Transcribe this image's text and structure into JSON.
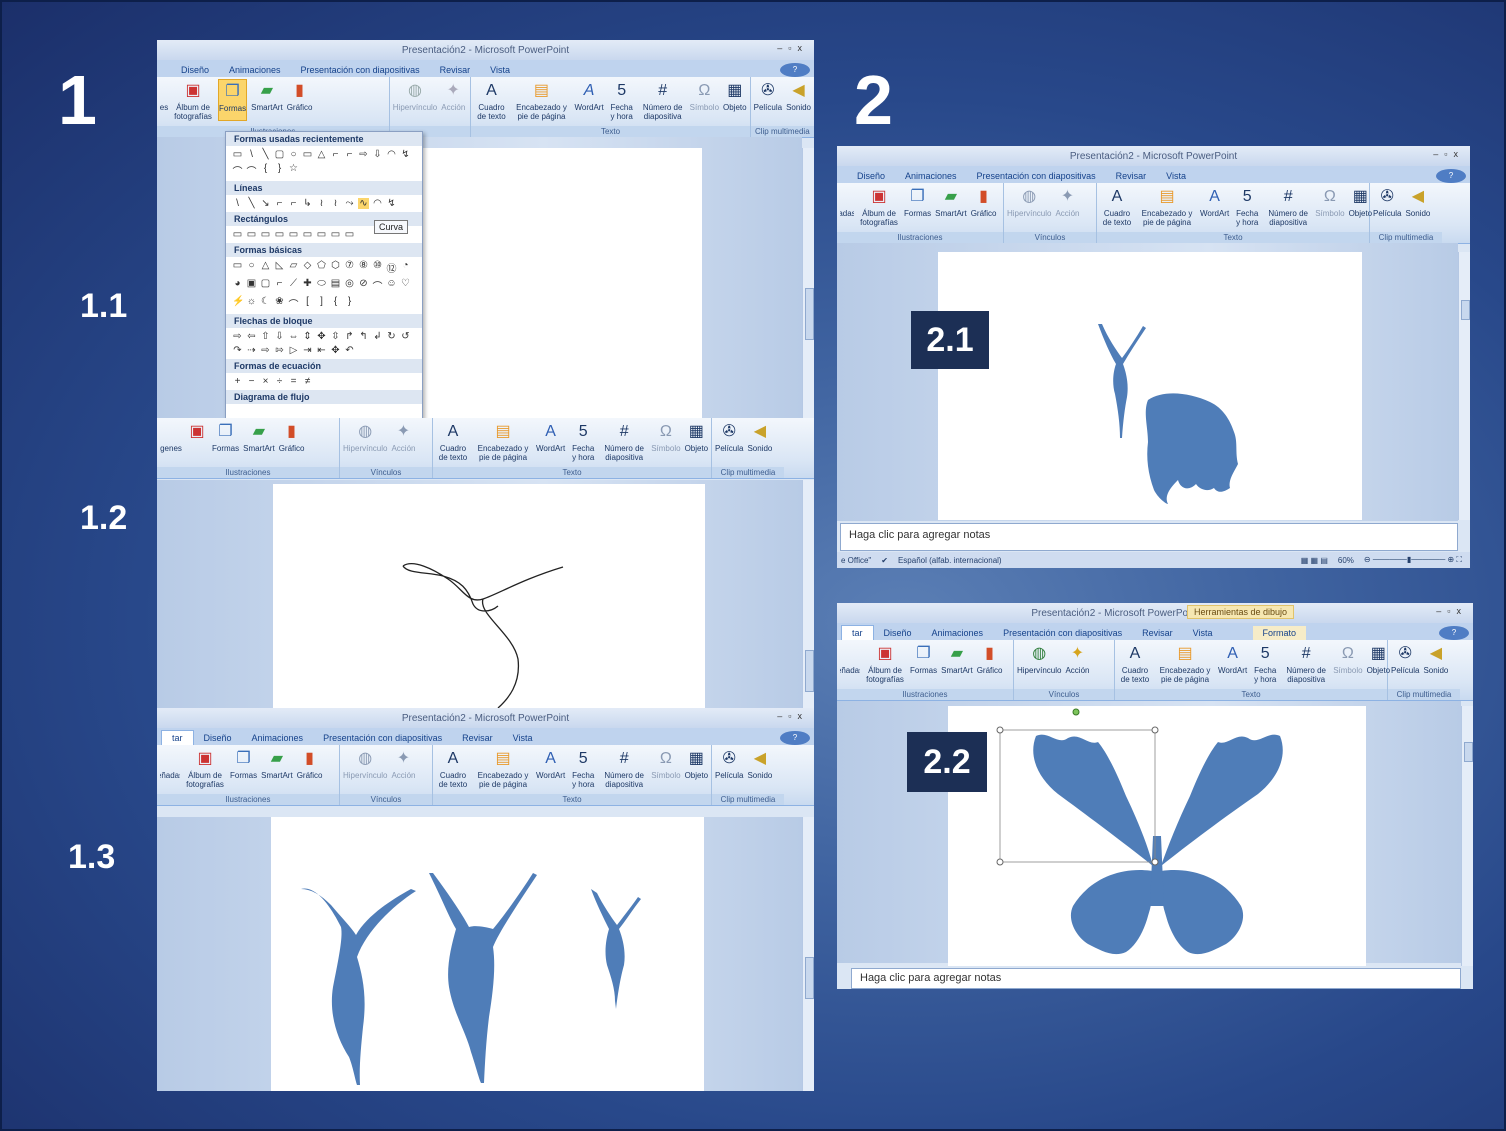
{
  "labels": {
    "n1": "1",
    "n2": "2",
    "s11": "1.1",
    "s12": "1.2",
    "s13": "1.3",
    "s21": "2.1",
    "s22": "2.2"
  },
  "window": {
    "title": "Presentación2 - Microsoft PowerPoint",
    "tabs": [
      "Diseño",
      "Animaciones",
      "Presentación con diapositivas",
      "Revisar",
      "Vista"
    ],
    "tabs_short": [
      "tar",
      "Diseño",
      "Animaciones",
      "Presentación con diapositivas",
      "Revisar",
      "Vista"
    ],
    "tabs_2_1": [
      "Diseño",
      "Animaciones",
      "Presentación con diapositivas",
      "Revisar",
      "Vista"
    ],
    "drawing_tools": "Herramientas de dibujo",
    "format_tab": "Formato"
  },
  "ribbon": {
    "ilu": [
      "Álbum de fotografías",
      "Formas",
      "SmartArt",
      "Gráfico"
    ],
    "ilu_label": "Ilustraciones",
    "vin": [
      "Hipervínculo",
      "Acción"
    ],
    "vin_label": "Vínculos",
    "txt": [
      "Cuadro de texto",
      "Encabezado y pie de página",
      "WordArt",
      "Fecha y hora",
      "Número de diapositiva",
      "Símbolo",
      "Objeto"
    ],
    "txt_label": "Texto",
    "clip": [
      "Película",
      "Sonido"
    ],
    "clip_label": "Clip multimedia",
    "cut_left_1": "es",
    "cut_left_2": "adas",
    "cut_left_3": "genes",
    "cut_left_4": "eñadas"
  },
  "shapes_menu": {
    "recent": "Formas usadas recientemente",
    "lines": "Líneas",
    "rects": "Rectángulos",
    "basic": "Formas básicas",
    "block": "Flechas de bloque",
    "equation": "Formas de ecuación",
    "flow": "Diagrama de flujo",
    "tooltip": "Curva"
  },
  "notes_text": "Haga clic para agregar notas",
  "status": {
    "office": "e Office\"",
    "lang": "Español (alfab. internacional)",
    "zoom": "60%"
  }
}
